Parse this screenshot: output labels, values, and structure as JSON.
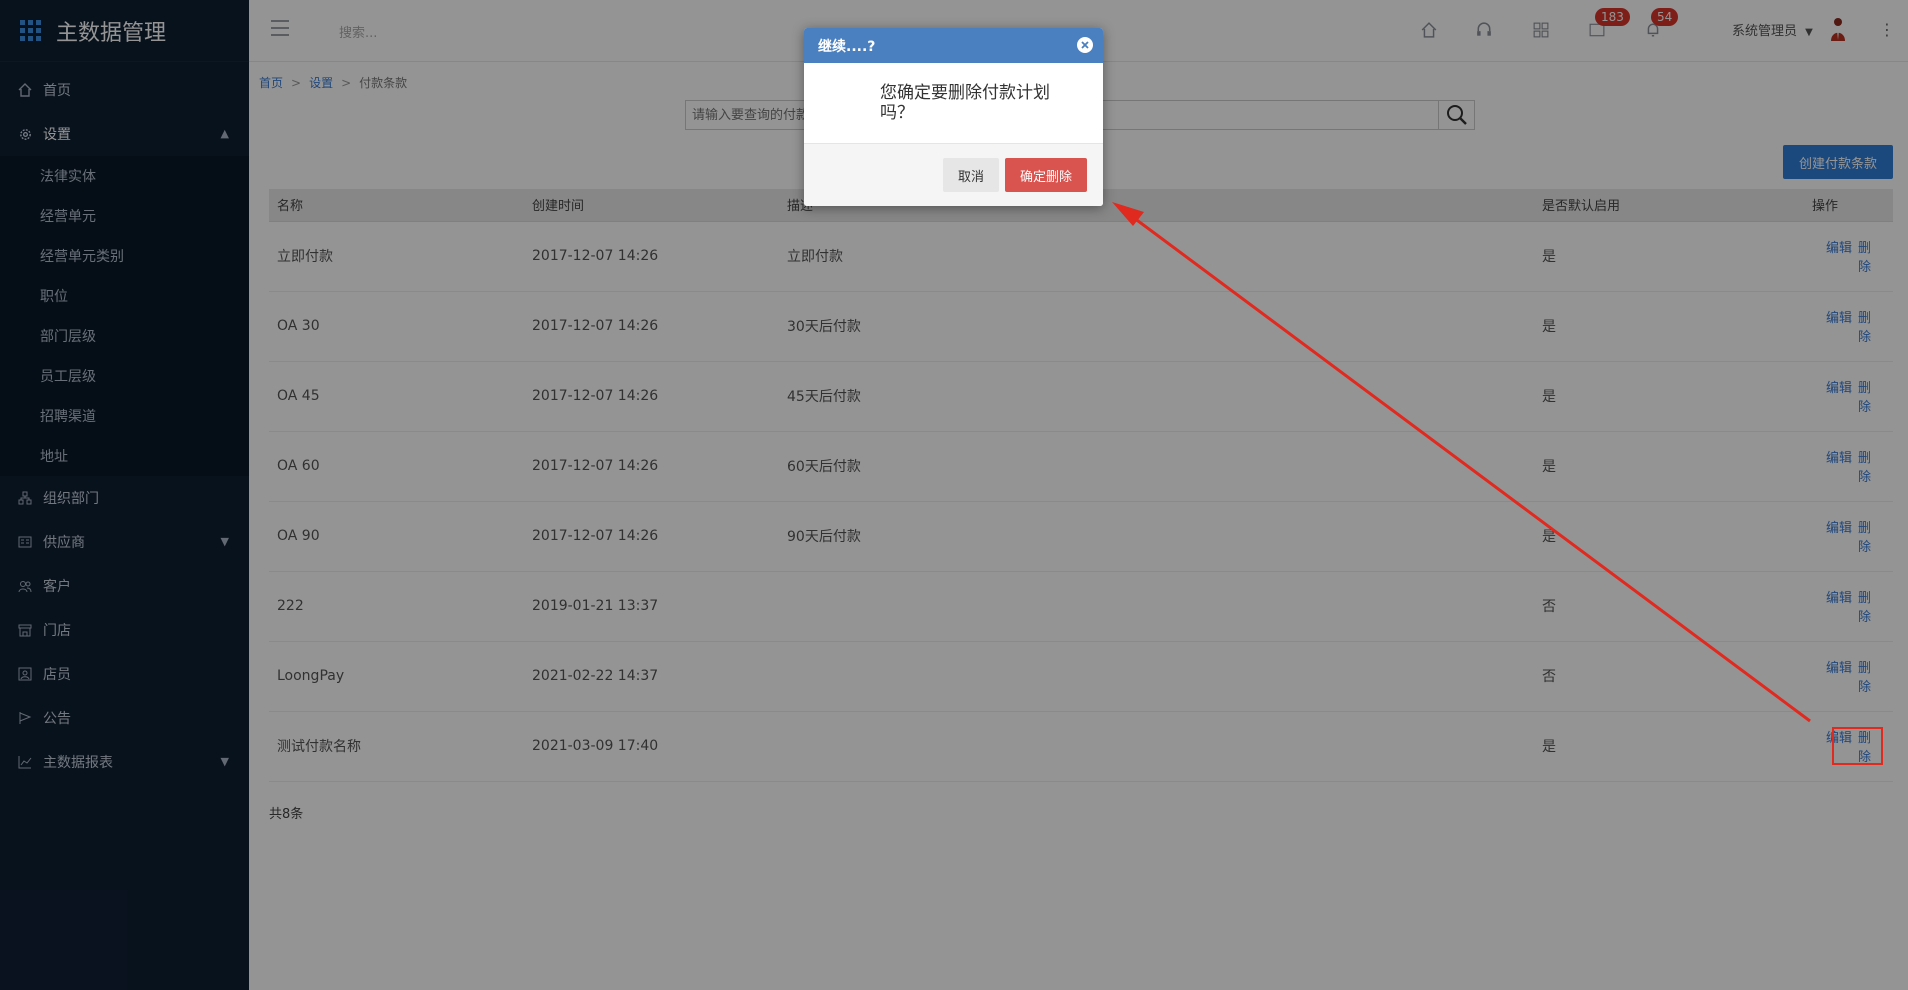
{
  "app": {
    "title": "主数据管理"
  },
  "sidebar": {
    "items": [
      {
        "label": "首页",
        "icon": "home-icon"
      },
      {
        "label": "设置",
        "icon": "gear-icon",
        "expanded": true,
        "children": [
          "法律实体",
          "经营单元",
          "经营单元类别",
          "职位",
          "部门层级",
          "员工层级",
          "招聘渠道",
          "地址"
        ]
      },
      {
        "label": "组织部门",
        "icon": "org-icon"
      },
      {
        "label": "供应商",
        "icon": "supplier-icon",
        "has_children": true
      },
      {
        "label": "客户",
        "icon": "customer-icon"
      },
      {
        "label": "门店",
        "icon": "store-icon"
      },
      {
        "label": "店员",
        "icon": "clerk-icon"
      },
      {
        "label": "公告",
        "icon": "announce-icon"
      },
      {
        "label": "主数据报表",
        "icon": "chart-icon",
        "has_children": true
      }
    ]
  },
  "topbar": {
    "search_placeholder": "搜索...",
    "badge_messages": "183",
    "badge_notifications": "54",
    "user_name": "系统管理员"
  },
  "breadcrumb": {
    "home": "首页",
    "settings": "设置",
    "current": "付款条款",
    "sep": ">"
  },
  "search": {
    "placeholder": "请输入要查询的付款条款名称"
  },
  "create_button": "创建付款条款",
  "table": {
    "headers": {
      "name": "名称",
      "created": "创建时间",
      "desc": "描述",
      "default": "是否默认启用",
      "actions": "操作"
    },
    "edit_label": "编辑",
    "delete_label": "删除",
    "rows": [
      {
        "name": "立即付款",
        "created": "2017-12-07 14:26",
        "desc": "立即付款",
        "default": "是"
      },
      {
        "name": "OA 30",
        "created": "2017-12-07 14:26",
        "desc": "30天后付款",
        "default": "是"
      },
      {
        "name": "OA 45",
        "created": "2017-12-07 14:26",
        "desc": "45天后付款",
        "default": "是"
      },
      {
        "name": "OA 60",
        "created": "2017-12-07 14:26",
        "desc": "60天后付款",
        "default": "是"
      },
      {
        "name": "OA 90",
        "created": "2017-12-07 14:26",
        "desc": "90天后付款",
        "default": "是"
      },
      {
        "name": "222",
        "created": "2019-01-21 13:37",
        "desc": "",
        "default": "否"
      },
      {
        "name": "LoongPay",
        "created": "2021-02-22 14:37",
        "desc": "",
        "default": "否"
      },
      {
        "name": "测试付款名称",
        "created": "2021-03-09 17:40",
        "desc": "",
        "default": "是"
      }
    ]
  },
  "total": "共8条",
  "dialog": {
    "title": "继续....?",
    "message": "您确定要删除付款计划吗？",
    "cancel_label": "取消",
    "confirm_label": "确定删除"
  },
  "colors": {
    "sidebar_bg": "#0f1f33",
    "dialog_header": "#4a7fc0",
    "confirm": "#d9534f",
    "primary": "#2f7ed8",
    "annotation": "#e0291f"
  }
}
